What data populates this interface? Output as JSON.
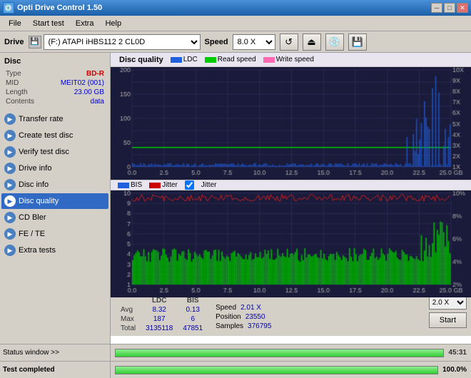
{
  "titlebar": {
    "icon": "💿",
    "title": "Opti Drive Control 1.50",
    "min_btn": "─",
    "max_btn": "□",
    "close_btn": "✕"
  },
  "menubar": {
    "items": [
      "File",
      "Start test",
      "Extra",
      "Help"
    ]
  },
  "drivebar": {
    "label": "Drive",
    "drive_value": "(F:)  ATAPI iHBS112  2 CL0D",
    "speed_label": "Speed",
    "speed_value": "8.0 X"
  },
  "disc": {
    "section_label": "Disc",
    "type_label": "Type",
    "type_value": "BD-R",
    "mid_label": "MID",
    "mid_value": "MEIT02 (001)",
    "length_label": "Length",
    "length_value": "23.00 GB",
    "contents_label": "Contents",
    "contents_value": "data"
  },
  "sidebar": {
    "buttons": [
      {
        "id": "transfer-rate",
        "label": "Transfer rate",
        "active": false
      },
      {
        "id": "create-test-disc",
        "label": "Create test disc",
        "active": false
      },
      {
        "id": "verify-test-disc",
        "label": "Verify test disc",
        "active": false
      },
      {
        "id": "drive-info",
        "label": "Drive info",
        "active": false
      },
      {
        "id": "disc-info",
        "label": "Disc info",
        "active": false
      },
      {
        "id": "disc-quality",
        "label": "Disc quality",
        "active": true
      },
      {
        "id": "cd-bler",
        "label": "CD Bler",
        "active": false
      },
      {
        "id": "fe-te",
        "label": "FE / TE",
        "active": false
      },
      {
        "id": "extra-tests",
        "label": "Extra tests",
        "active": false
      }
    ]
  },
  "chart": {
    "title": "Disc quality",
    "upper": {
      "legend": [
        {
          "label": "LDC",
          "color": "#2060e0"
        },
        {
          "label": "Read speed",
          "color": "#00cc00"
        },
        {
          "label": "Write speed",
          "color": "#ff69b4"
        }
      ],
      "y_max": 200,
      "y_labels_left": [
        "200",
        "150",
        "100",
        "50",
        "0"
      ],
      "y_labels_right": [
        "10X",
        "9X",
        "8X",
        "7X",
        "6X",
        "5X",
        "4X",
        "3X",
        "2X",
        "1X"
      ],
      "x_labels": [
        "0.0",
        "2.5",
        "5.0",
        "7.5",
        "10.0",
        "12.5",
        "15.0",
        "17.5",
        "20.0",
        "22.5",
        "25.0 GB"
      ]
    },
    "lower": {
      "legend": [
        {
          "label": "BIS",
          "color": "#2060e0"
        },
        {
          "label": "Jitter",
          "color": "#cc0000"
        }
      ],
      "y_max": 10,
      "y_labels_left": [
        "10",
        "9",
        "8",
        "7",
        "6",
        "5",
        "4",
        "3",
        "2",
        "1"
      ],
      "y_labels_right": [
        "10%",
        "8%",
        "6%",
        "4%",
        "2%"
      ],
      "x_labels": [
        "0.0",
        "2.5",
        "5.0",
        "7.5",
        "10.0",
        "12.5",
        "15.0",
        "17.5",
        "20.0",
        "22.5",
        "25.0 GB"
      ]
    }
  },
  "stats": {
    "col_ldc": "LDC",
    "col_bis": "BIS",
    "avg_label": "Avg",
    "avg_ldc": "8.32",
    "avg_bis": "0.13",
    "max_label": "Max",
    "max_ldc": "187",
    "max_bis": "6",
    "total_label": "Total",
    "total_ldc": "3135118",
    "total_bis": "47851",
    "jitter_label": "Jitter",
    "speed_label": "Speed",
    "speed_value": "2.01 X",
    "position_label": "Position",
    "position_value": "23550",
    "samples_label": "Samples",
    "samples_value": "376795",
    "speed_select": "2.0 X",
    "start_btn": "Start"
  },
  "statusbar": {
    "status_window_label": "Status window >>",
    "progress_pct": 100,
    "time": "45:31"
  },
  "completion": {
    "label": "Test completed",
    "progress_pct": 100,
    "pct_display": "100.0%"
  }
}
